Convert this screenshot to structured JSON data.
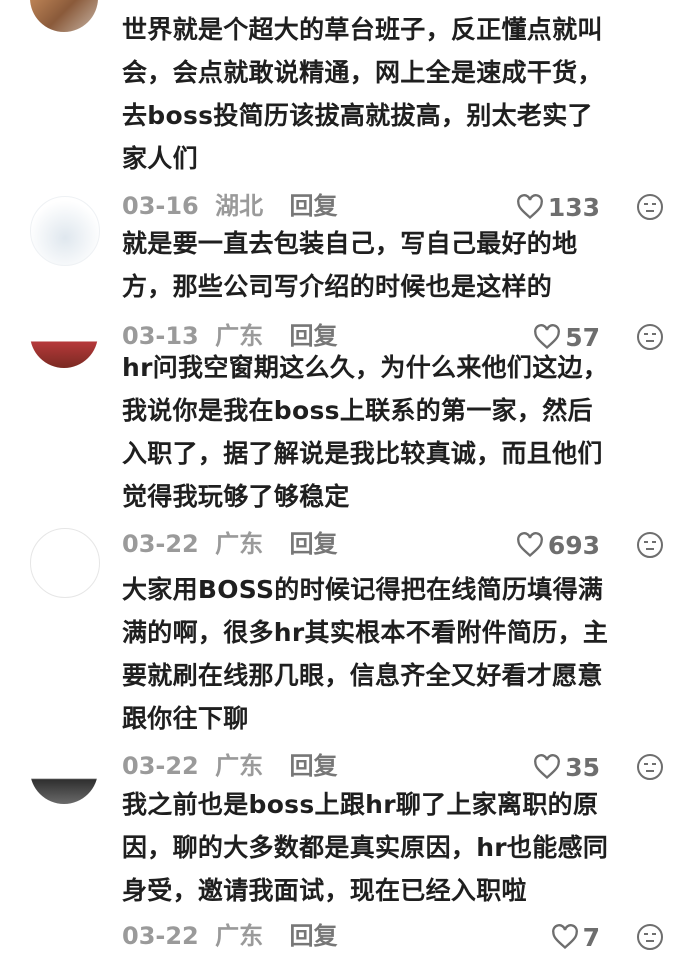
{
  "comments": [
    {
      "lines": [
        "世界就是个超大的草台班子，反正懂点就叫",
        "会，会点就敢说精通，网上全是速成干货，",
        "去boss投简历该拔高就拔高，别太老实了",
        "家人们"
      ],
      "date": "03-16",
      "location": "湖北",
      "reply": "回复",
      "likes": "133"
    },
    {
      "lines": [
        "就是要一直去包装自己，写自己最好的地",
        "方，那些公司写介绍的时候也是这样的"
      ],
      "date": "03-13",
      "location": "广东",
      "reply": "回复",
      "likes": "57"
    },
    {
      "lines": [
        "hr问我空窗期这么久，为什么来他们这边，",
        "我说你是我在boss上联系的第一家，然后",
        "入职了，据了解说是我比较真诚，而且他们",
        "觉得我玩够了够稳定"
      ],
      "date": "03-22",
      "location": "广东",
      "reply": "回复",
      "likes": "693"
    },
    {
      "lines": [
        "大家用BOSS的时候记得把在线简历填得满",
        "满的啊，很多hr其实根本不看附件简历，主",
        "要就刷在线那几眼，信息齐全又好看才愿意",
        "跟你往下聊"
      ],
      "date": "03-22",
      "location": "广东",
      "reply": "回复",
      "likes": "35"
    },
    {
      "lines": [
        "我之前也是boss上跟hr聊了上家离职的原",
        "因，聊的大多数都是真实原因，hr也能感同",
        "身受，邀请我面试，现在已经入职啦"
      ],
      "date": "03-22",
      "location": "广东",
      "reply": "回复",
      "likes": "7"
    }
  ],
  "colors": {
    "text": "#1f1f1f",
    "meta": "#9a9a9a",
    "icon": "#6e6e6e"
  },
  "icons": {
    "like": "heart-outline-icon",
    "dislike": "unamused-face-icon"
  }
}
